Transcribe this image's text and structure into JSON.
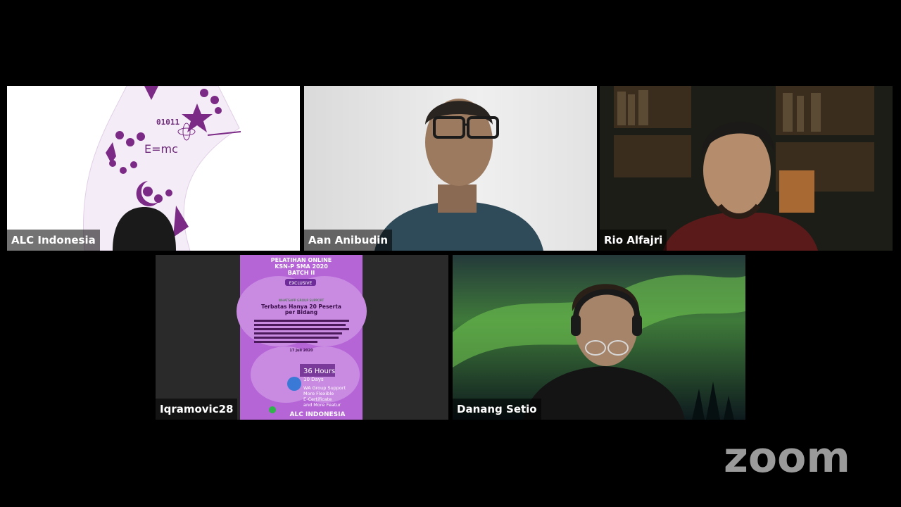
{
  "participants": [
    {
      "name": "ALC Indonesia"
    },
    {
      "name": "Aan Anibudin"
    },
    {
      "name": "Rio Alfajri"
    },
    {
      "name": "Iqramovic28"
    },
    {
      "name": "Danang Setio"
    }
  ],
  "logo": {
    "text": "zoom",
    "color": "#9a9a9a"
  },
  "slide": {
    "formula": "E=mc",
    "binary": "01011"
  },
  "poster": {
    "title1": "PELATIHAN ONLINE",
    "title2": "KSN-P SMA 2020",
    "title3": "BATCH II",
    "badge": "EXCLUSIVE",
    "support": "WHATSAPP GROUP SUPPORT",
    "headline1": "Terbatas Hanya 20 Peserta",
    "headline2": "per Bidang",
    "date": "17 Juli 2020",
    "hours": "36 Hours",
    "days": "10 Days",
    "feature1": "WA Group Support",
    "feature2": "More Flexible",
    "feature3": "E-Certificate",
    "feature4": "and More Featur",
    "footer": "ALC INDONESIA"
  },
  "colors": {
    "brand_purple": "#b565d6",
    "label_bg": "rgba(0,0,0,0.55)"
  }
}
